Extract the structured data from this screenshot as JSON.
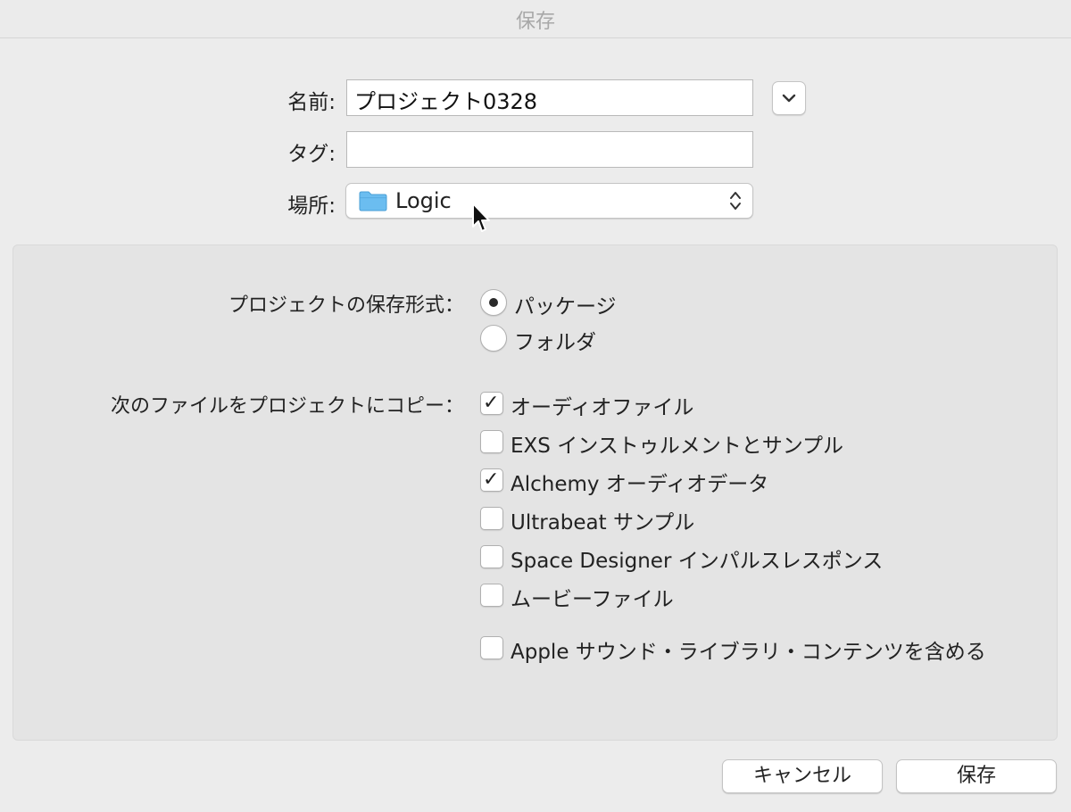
{
  "window": {
    "title": "保存"
  },
  "form": {
    "name_label": "名前:",
    "name_value": "プロジェクト0328",
    "tag_label": "タグ:",
    "tag_value": "",
    "location_label": "場所:",
    "location_value": "Logic"
  },
  "options": {
    "format_label": "プロジェクトの保存形式：",
    "format_options": [
      {
        "label": "パッケージ",
        "selected": true
      },
      {
        "label": "フォルダ",
        "selected": false
      }
    ],
    "copy_label": "次のファイルをプロジェクトにコピー：",
    "copy_items": [
      {
        "label": "オーディオファイル",
        "checked": true
      },
      {
        "label": "EXS インストゥルメントとサンプル",
        "checked": false
      },
      {
        "label": "Alchemy オーディオデータ",
        "checked": true
      },
      {
        "label": "Ultrabeat サンプル",
        "checked": false
      },
      {
        "label": "Space Designer インパルスレスポンス",
        "checked": false
      },
      {
        "label": "ムービーファイル",
        "checked": false
      },
      {
        "label": "Apple サウンド・ライブラリ・コンテンツを含める",
        "checked": false
      }
    ]
  },
  "buttons": {
    "cancel": "キャンセル",
    "save": "保存"
  },
  "icons": {
    "expand": "chevron-down-icon",
    "folder": "folder-icon",
    "popup_arrows": "up-down-chevron-icon",
    "cursor": "mouse-pointer-icon"
  },
  "colors": {
    "folder": "#6bbdf0"
  }
}
